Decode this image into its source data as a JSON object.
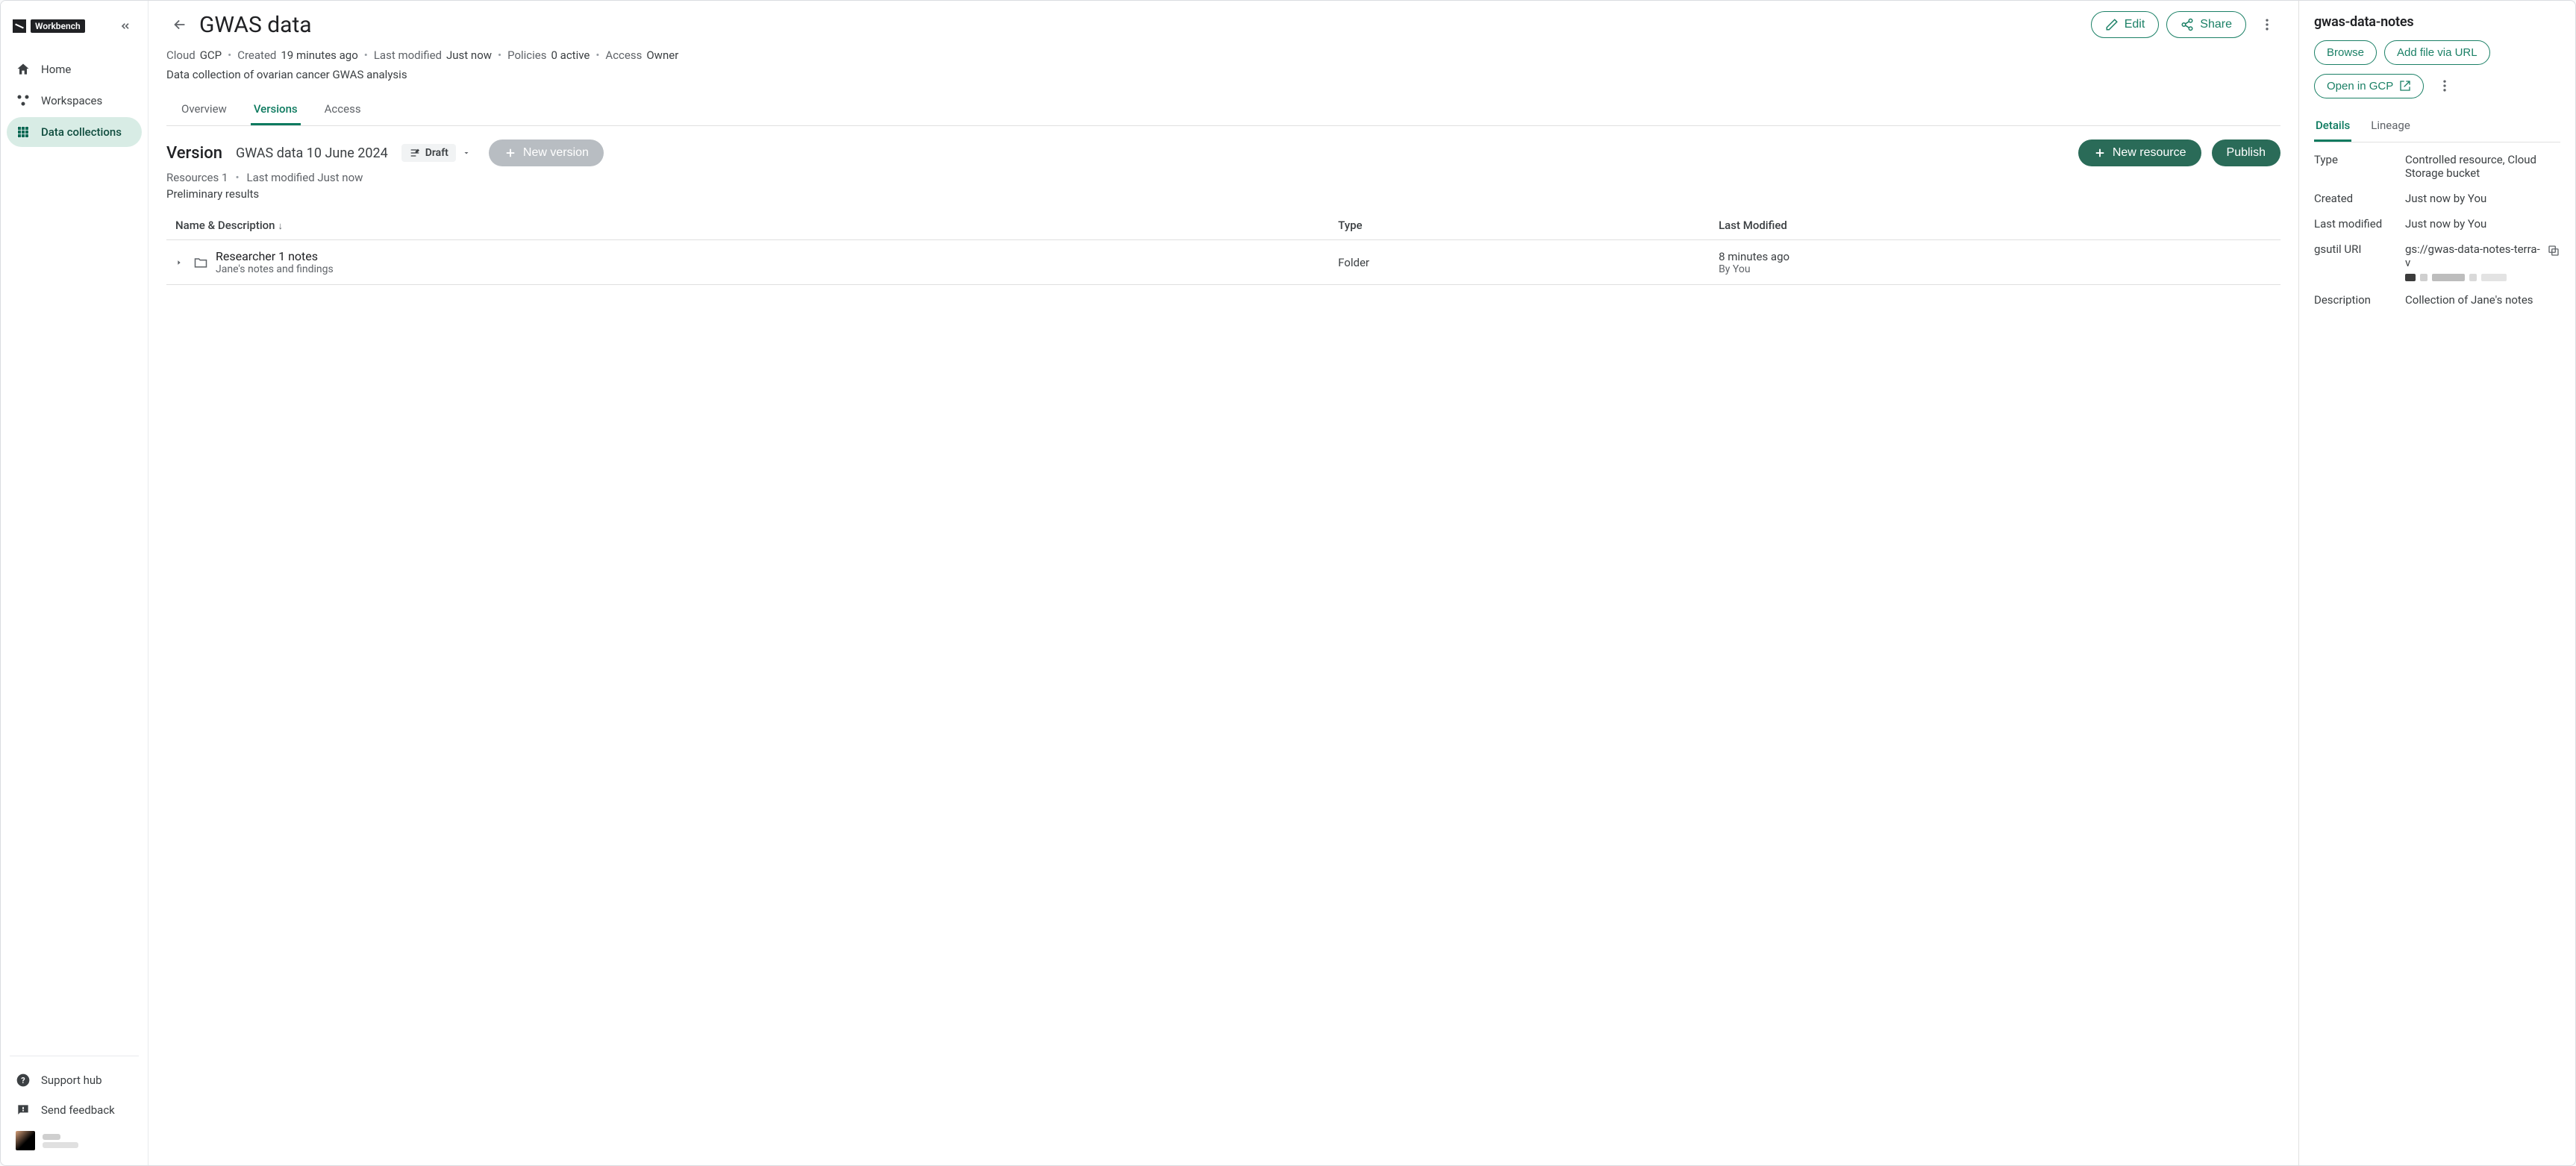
{
  "brand": {
    "name": "Workbench"
  },
  "sidebar": {
    "items": [
      {
        "label": "Home"
      },
      {
        "label": "Workspaces"
      },
      {
        "label": "Data collections"
      }
    ],
    "support": "Support hub",
    "feedback": "Send feedback"
  },
  "header": {
    "title": "GWAS data",
    "edit": "Edit",
    "share": "Share",
    "meta": {
      "cloud_label": "Cloud",
      "cloud_value": "GCP",
      "created_label": "Created",
      "created_value": "19 minutes ago",
      "modified_label": "Last modified",
      "modified_value": "Just now",
      "policies_label": "Policies",
      "policies_value": "0 active",
      "access_label": "Access",
      "access_value": "Owner"
    },
    "description": "Data collection of ovarian cancer GWAS analysis",
    "tabs": {
      "overview": "Overview",
      "versions": "Versions",
      "access": "Access"
    }
  },
  "version": {
    "label": "Version",
    "name": "GWAS data 10 June 2024",
    "draft_chip": "Draft",
    "new_version": "New version",
    "new_resource": "New resource",
    "publish": "Publish",
    "meta": {
      "resources_label": "Resources",
      "resources_value": "1",
      "modified_label": "Last modified",
      "modified_value": "Just now"
    },
    "description": "Preliminary results",
    "columns": {
      "name": "Name & Description",
      "type": "Type",
      "modified": "Last Modified"
    },
    "rows": [
      {
        "name": "Researcher 1 notes",
        "sub": "Jane's notes and findings",
        "type": "Folder",
        "modified_time": "8 minutes ago",
        "modified_by": "By You"
      }
    ]
  },
  "right": {
    "title": "gwas-data-notes",
    "browse": "Browse",
    "add_url": "Add file via URL",
    "open_gcp": "Open in GCP",
    "tabs": {
      "details": "Details",
      "lineage": "Lineage"
    },
    "details": {
      "type_label": "Type",
      "type_value": "Controlled resource, Cloud Storage bucket",
      "created_label": "Created",
      "created_value": "Just now by You",
      "modified_label": "Last modified",
      "modified_value": "Just now by You",
      "uri_label": "gsutil URI",
      "uri_value": "gs://gwas-data-notes-terra-v",
      "desc_label": "Description",
      "desc_value": "Collection of Jane's notes"
    }
  }
}
